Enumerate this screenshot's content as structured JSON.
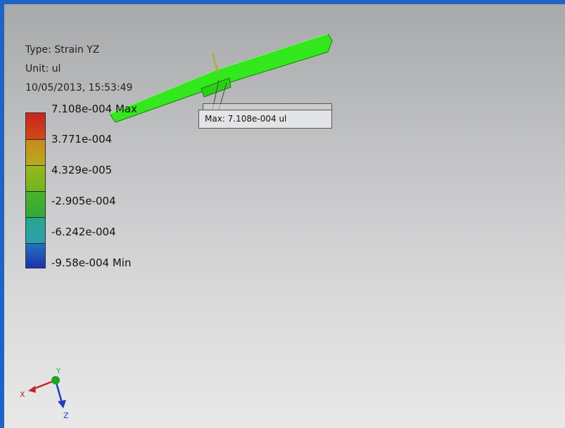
{
  "result": {
    "type_label": "Type: Strain YZ",
    "unit_label": "Unit: ul",
    "timestamp": "10/05/2013, 15:53:49"
  },
  "legend": {
    "labels": [
      "7.108e-004 Max",
      "3.771e-004",
      "4.329e-005",
      "-2.905e-004",
      "-6.242e-004",
      "-9.58e-004 Min"
    ],
    "colors": [
      "#c8241e",
      "#b89a1e",
      "#72b81e",
      "#33a83a",
      "#2aa6a8",
      "#1b47b7"
    ]
  },
  "probe": {
    "label": "Max: 7.108e-004 ul"
  },
  "triad": {
    "x_label": "X",
    "y_label": "Y",
    "z_label": "Z"
  }
}
